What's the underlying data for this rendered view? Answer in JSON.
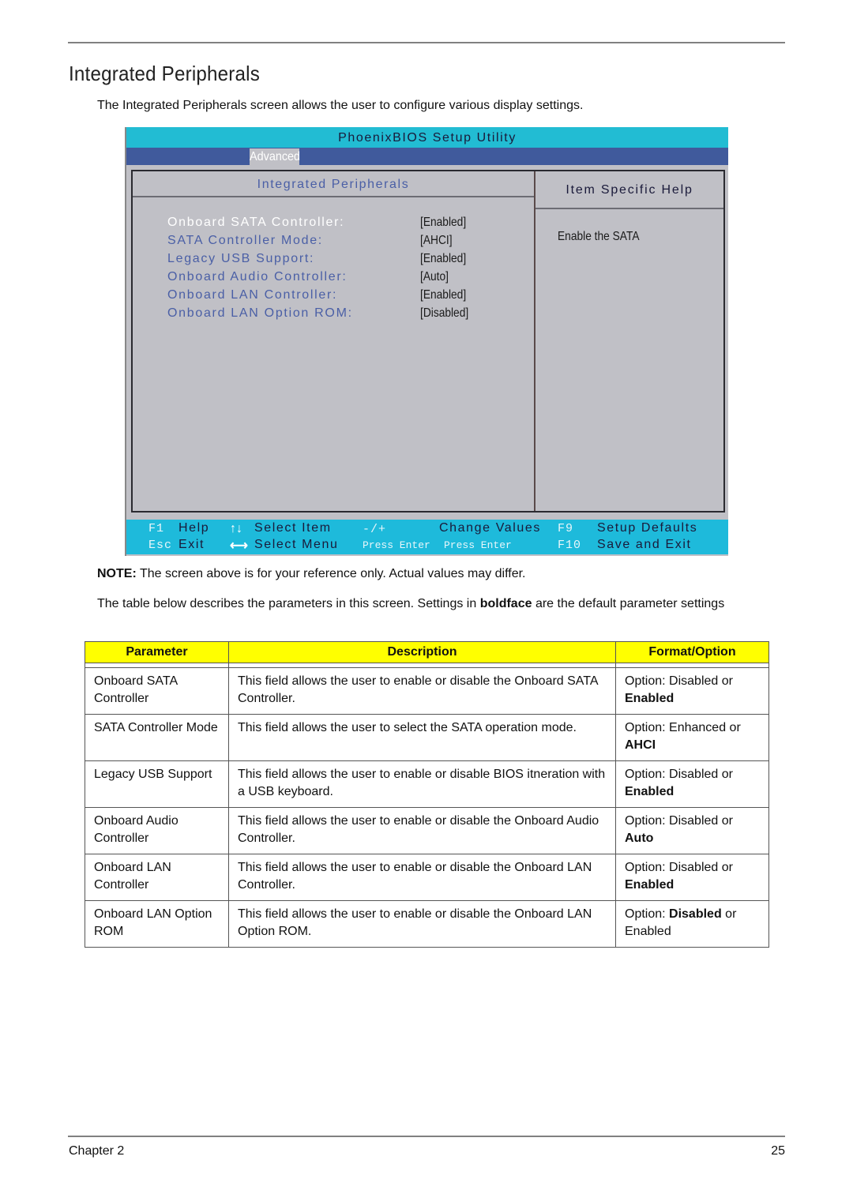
{
  "page": {
    "title": "Integrated Peripherals",
    "intro": "The Integrated Peripherals screen allows the user to configure various display settings.",
    "note_label": "NOTE:",
    "note_text": " The screen above is for your reference only. Actual values may differ.",
    "para_before": "The table below describes the parameters in this screen. Settings in ",
    "para_bold": "boldface",
    "para_after": " are the default parameter settings",
    "footer_left": "Chapter 2",
    "footer_right": "25"
  },
  "bios": {
    "utility_title": "PhoenixBIOS Setup Utility",
    "active_tab": "Advanced",
    "panel_title": "Integrated Peripherals",
    "help_title": "Item Specific Help",
    "help_text": "Enable the SATA",
    "items": [
      {
        "label": "Onboard SATA Controller:",
        "value": "[Enabled]",
        "selected": true
      },
      {
        "label": "SATA Controller Mode:",
        "value": "[AHCI]",
        "selected": false
      },
      {
        "label": "Legacy USB Support:",
        "value": "[Enabled]",
        "selected": false
      },
      {
        "label": "Onboard Audio Controller:",
        "value": "[Auto]",
        "selected": false
      },
      {
        "label": "Onboard LAN Controller:",
        "value": "[Enabled]",
        "selected": false
      },
      {
        "label": "Onboard LAN Option ROM:",
        "value": "[Disabled]",
        "selected": false
      }
    ],
    "footer": {
      "f1_key": "F1",
      "f1_label": "Help",
      "esc_key": "Esc",
      "esc_label": "Exit",
      "updown_icon": "↑↓",
      "updown_label": "Select Item",
      "leftright_icon": "⟷",
      "leftright_label": "Select Menu",
      "plusminus_key": "-/+",
      "plusminus_label": "Change Values",
      "enter_key": "Press Enter",
      "enter_label": "Press Enter",
      "f9_key": "F9",
      "f9_label": "Setup Defaults",
      "f10_key": "F10",
      "f10_label": "Save and Exit"
    }
  },
  "table": {
    "headers": [
      "Parameter",
      "Description",
      "Format/Option"
    ],
    "rows": [
      {
        "param": "Onboard SATA Controller",
        "desc": "This field allows the user to enable or disable the Onboard SATA Controller.",
        "opt_pre": "Option: Disabled or ",
        "opt_bold": "Enabled",
        "opt_post": ""
      },
      {
        "param": "SATA Controller Mode",
        "desc": "This field allows the user to select the SATA operation mode.",
        "opt_pre": "Option: Enhanced or ",
        "opt_bold": "AHCI",
        "opt_post": ""
      },
      {
        "param": "Legacy USB Support",
        "desc": "This field allows the user to enable or disable BIOS itneration with a USB keyboard.",
        "opt_pre": "Option: Disabled or ",
        "opt_bold": "Enabled",
        "opt_post": ""
      },
      {
        "param": "Onboard Audio Controller",
        "desc": "This field allows the user to enable or disable the Onboard Audio Controller.",
        "opt_pre": "Option: Disabled or ",
        "opt_bold": "Auto",
        "opt_post": ""
      },
      {
        "param": "Onboard LAN Controller",
        "desc": "This field allows the user to enable or disable the Onboard LAN Controller.",
        "opt_pre": "Option: Disabled or ",
        "opt_bold": "Enabled",
        "opt_post": ""
      },
      {
        "param": "Onboard LAN Option ROM",
        "desc": "This field allows the user to enable or disable the Onboard LAN Option ROM.",
        "opt_pre": "Option: ",
        "opt_bold": "Disabled",
        "opt_post": " or Enabled"
      }
    ]
  },
  "colors": {
    "bios_titlebar": "#22bcd3",
    "bios_menubar": "#405a9c",
    "bios_background": "#c0c0c6",
    "bios_label": "#4a5fa6",
    "table_header": "#ffff00"
  }
}
